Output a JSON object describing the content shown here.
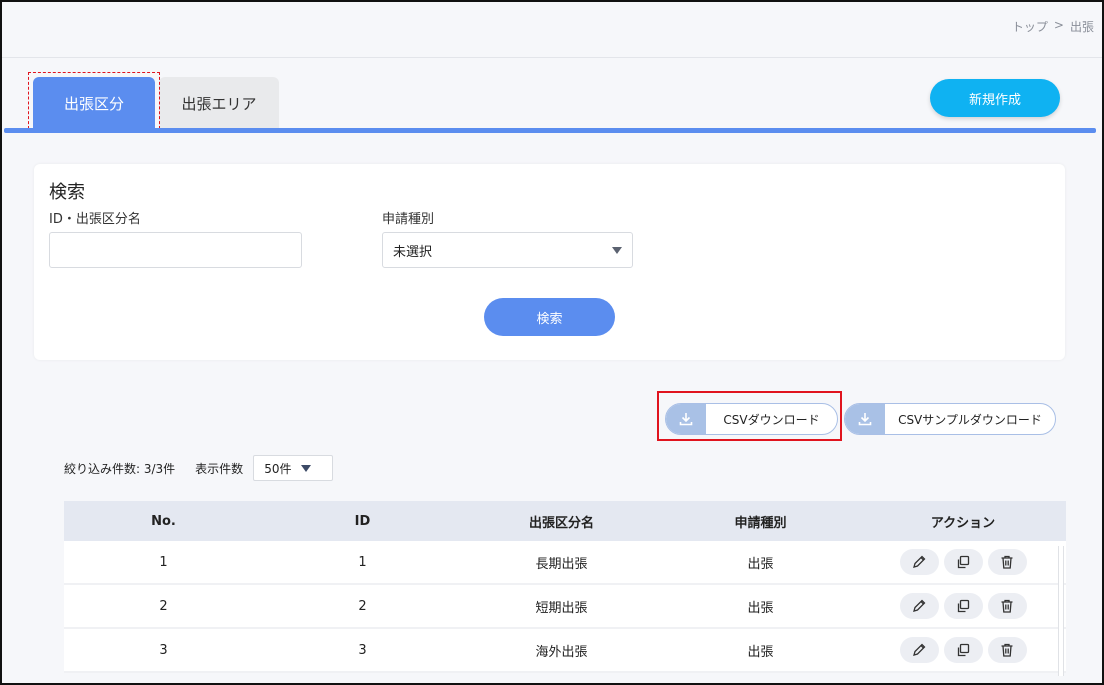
{
  "breadcrumb": {
    "home": "トップ",
    "separator": ">",
    "current": "出張"
  },
  "tabs": [
    {
      "label": "出張区分",
      "active": true
    },
    {
      "label": "出張エリア",
      "active": false
    }
  ],
  "actions": {
    "new_label": "新規作成"
  },
  "search": {
    "title": "検索",
    "id_label": "ID・出張区分名",
    "id_value": "",
    "type_label": "申請種別",
    "type_value": "未選択",
    "button_label": "検索"
  },
  "csv": {
    "download_label": "CSVダウンロード",
    "sample_download_label": "CSVサンプルダウンロード"
  },
  "list": {
    "filter_count_label": "絞り込み件数: 3/3件",
    "per_page_label": "表示件数",
    "per_page_value": "50件"
  },
  "table": {
    "headers": [
      "No.",
      "ID",
      "出張区分名",
      "申請種別",
      "アクション"
    ],
    "rows": [
      {
        "no": "1",
        "id": "1",
        "name": "長期出張",
        "type": "出張"
      },
      {
        "no": "2",
        "id": "2",
        "name": "短期出張",
        "type": "出張"
      },
      {
        "no": "3",
        "id": "3",
        "name": "海外出張",
        "type": "出張"
      }
    ]
  },
  "colors": {
    "primary": "#5b8def",
    "new_button": "#0fb2f2",
    "highlight": "#e0141e"
  },
  "icons": {
    "edit": "pencil-icon",
    "copy": "copy-icon",
    "delete": "trash-icon",
    "download": "download-icon",
    "dropdown": "chevron-down-icon"
  }
}
